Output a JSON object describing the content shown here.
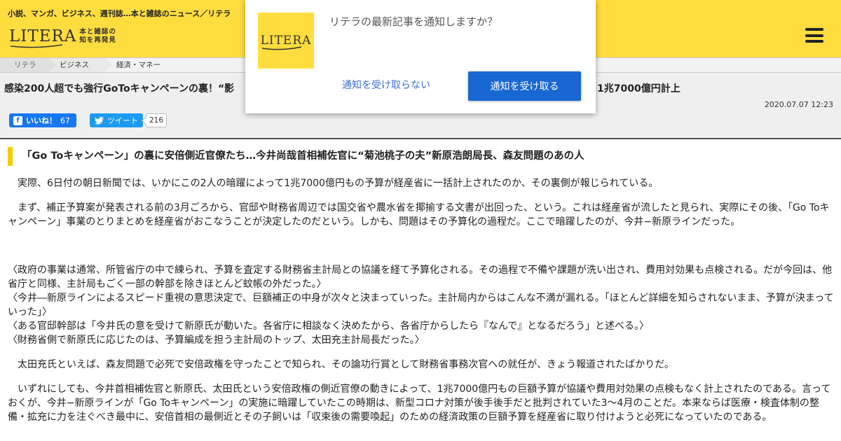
{
  "header": {
    "tagline": "小説、マンガ、ビジネス、週刊誌…本と雑誌のニュース／リテラ",
    "logo_text": "LITERA",
    "logo_sub_line1": "本と雑誌の",
    "logo_sub_line2": "知を再発見",
    "menu_icon": "hamburger-icon"
  },
  "breadcrumb": [
    "リテラ",
    "ビジネス",
    "経済・マネー"
  ],
  "article": {
    "title_start": "感染200人超でも強行GoToキャンペーンの裏！“影",
    "title_end": "1兆7000億円計上",
    "date": "2020.07.07 12:23",
    "like_label": "いいね！",
    "like_count": "67",
    "tweet_label": "ツイート",
    "tweet_count": "216",
    "subheading": "「Go Toキャンペーン」の裏に安倍側近官僚たち…今井尚哉首相補佐官に“菊池桃子の夫”新原浩朗局長、森友問題のあの人",
    "paragraphs": [
      "実際、6日付の朝日新聞では、いかにこの2人の暗躍によって1兆7000億円もの予算が経産省に一括計上されたのか、その裏側が報じられている。",
      "まず、補正予算案が発表される前の3月ごろから、官邸や財務省周辺では国交省や農水省を揶揄する文書が出回った、という。これは経産省が流したと見られ、実際にその後、「Go Toキャンペーン」事業のとりまとめを経産省がおこなうことが決定したのだという。しかも、問題はその予算化の過程だ。ここで暗躍したのが、今井−新原ラインだった。",
      "太田充氏といえば、森友問題で必死で安倍政権を守ったことで知られ、その論功行賞として財務省事務次官への就任が、きょう報道されたばかりだ。",
      "いずれにしても、今井首相補佐官と新原氏、太田氏という安倍政権の側近官僚の動きによって、1兆7000億円もの巨額予算が協議や費用対効果の点検もなく計上されたのである。言っておくが、今井−新原ラインが「Go Toキャンペーン」の実施に暗躍していたこの時期は、新型コロナ対策が後手後手だと批判されていた3〜4月のことだ。本来ならば医療・検査体制の整備・拡充に力を注ぐべき最中に、安倍首相の最側近とその子飼いは「収束後の需要喚起」のための経済政策の巨額予算を経産省に取り付けようと必死になっていたのである。"
    ],
    "quotes": [
      "〈政府の事業は通常、所管省庁の中で練られ、予算を査定する財務省主計局との協議を経て予算化される。その過程で不備や課題が洗い出され、費用対効果も点検される。だが今回は、他省庁と同様、主計局もごく一部の幹部を除きほとんど蚊帳の外だった。〉",
      "〈今井―新原ラインによるスピード重視の意思決定で、巨額補正の中身が次々と決まっていった。主計局内からはこんな不満が漏れる。「ほとんど詳細を知らされないまま、予算が決まっていった」〉",
      "〈ある官邸幹部は「今井氏の意を受けて新原氏が動いた。各省庁に相談なく決めたから、各省庁からしたら『なんで』となるだろう」と述べる。〉",
      "〈財務省側で新原氏に応じたのは、予算編成を担う主計局のトップ、太田充主計局長だった。〉"
    ]
  },
  "notification": {
    "question": "リテラの最新記事を通知しますか？",
    "decline_label": "通知を受け取らない",
    "accept_label": "通知を受け取る"
  },
  "colors": {
    "brand_yellow": "#ffdd3f",
    "accent_yellow": "#f4cd00",
    "facebook_blue": "#1877f2",
    "twitter_blue": "#1d9bf0",
    "dialog_button_blue": "#1967d2"
  }
}
